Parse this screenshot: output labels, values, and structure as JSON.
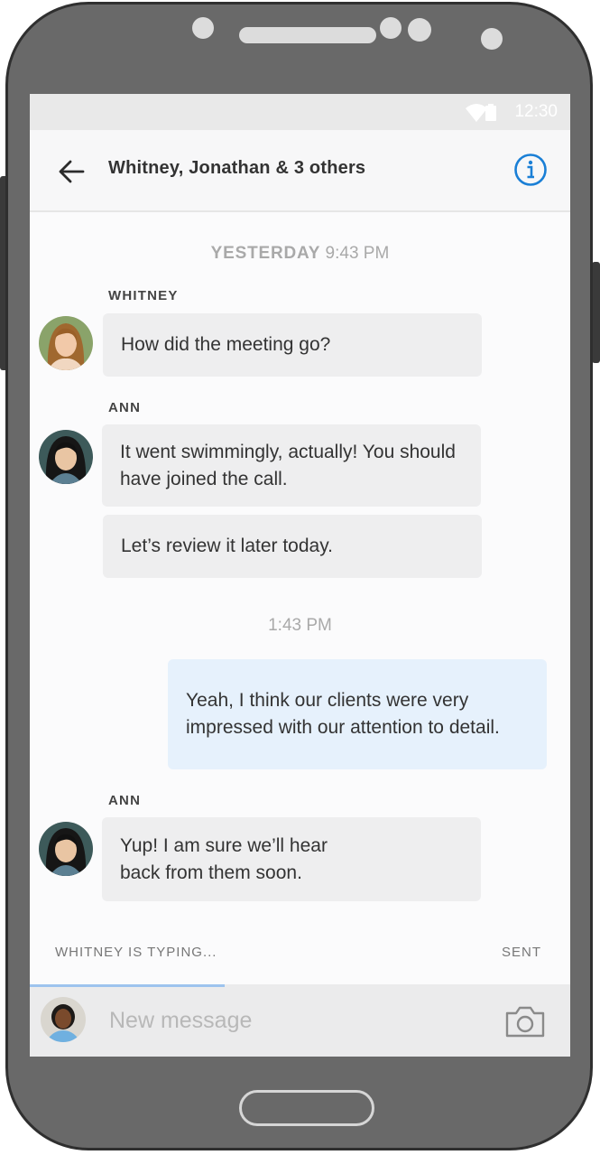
{
  "status_bar": {
    "time": "12:30",
    "icons": [
      "wifi-icon",
      "battery-icon"
    ]
  },
  "header": {
    "back_icon": "arrow-left-icon",
    "title": "Whitney, Jonathan & 3 others",
    "info_icon": "info-icon"
  },
  "conversation": {
    "timestamp_1": {
      "day": "YESTERDAY",
      "time": "9:43 PM"
    },
    "group_1": {
      "sender": "WHITNEY",
      "messages": [
        "How did the meeting go?"
      ]
    },
    "group_2": {
      "sender": "ANN",
      "messages": [
        "It went swimmingly, actually! You should have joined the call.",
        "Let’s review it later today."
      ]
    },
    "timestamp_2": "1:43 PM",
    "outgoing": {
      "messages": [
        "Yeah, I think our clients were very impressed with our attention to detail."
      ]
    },
    "group_3": {
      "sender": "ANN",
      "messages": [
        "Yup! I am sure we’ll hear back from them soon."
      ]
    }
  },
  "footer": {
    "typing": "WHITNEY IS TYPING...",
    "status": "SENT"
  },
  "composer": {
    "placeholder": "New message",
    "value": "",
    "camera_icon": "camera-icon"
  },
  "colors": {
    "accent": "#1a7fd6",
    "outgoing_bubble": "#e6f1fc",
    "incoming_bubble": "#eeeeef",
    "device": "#696969"
  }
}
